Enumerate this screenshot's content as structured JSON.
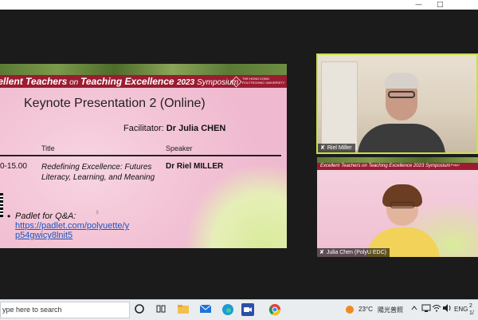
{
  "window": {
    "minimize": "—",
    "restore": "□"
  },
  "slide": {
    "header_excellent_1": "Excellent",
    "header_teachers": " Teachers",
    "header_on": " on ",
    "header_teaching": "Teaching",
    "header_excellence": " Excellence ",
    "header_year": "2023",
    "header_symposium": " Symposium",
    "university_line1": "THE HONG KONG",
    "university_line2": "POLYTECHNIC UNIVERSITY",
    "university_line3": "香港理工大學",
    "title": "Keynote Presentation 2 (Online)",
    "facilitator_label": "Facilitator: ",
    "facilitator_name": "Dr Julia CHEN",
    "col_title": "Title",
    "col_speaker": "Speaker",
    "time": "0-15.00",
    "talk_title": "Redefining Excellence: Futures Literacy, Learning, and Meaning",
    "speaker": "Dr Riel MILLER",
    "bullet": "•",
    "padlet_label": "Padlet for Q&A:",
    "padlet_url": "https://padlet.com/polyuette/yp54gwicy8lnit5",
    "cursor": "ᛟ"
  },
  "participants": [
    {
      "name": "Riel Miller",
      "mic_icon": "✘"
    },
    {
      "name": "Julia Chen (PolyU EDC)",
      "mic_icon": "✘"
    }
  ],
  "julia_slide": {
    "header": "Excellent Teachers on Teaching Excellence 2023 Symposium",
    "logo": "PolyU"
  },
  "taskbar": {
    "search_placeholder": "ype here to search",
    "temperature": "23°C",
    "weather_text": "陽光普照",
    "language": "ENG",
    "clock_time": "2",
    "clock_date": "1/"
  },
  "colors": {
    "header_red": "#9b1c31",
    "active_speaker_border": "#c8e04a",
    "link_blue": "#1a55c0"
  }
}
